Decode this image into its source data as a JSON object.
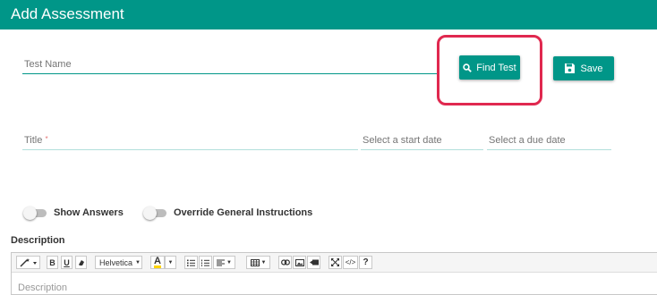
{
  "header": {
    "title": "Add Assessment"
  },
  "form": {
    "test_name_label": "Test Name",
    "title_label": "Title",
    "title_required_mark": "*",
    "start_date_label": "Select a start date",
    "due_date_label": "Select a due date"
  },
  "buttons": {
    "find_test": "Find Test",
    "save": "Save"
  },
  "toggles": {
    "show_answers": "Show Answers",
    "override_instructions": "Override General Instructions"
  },
  "description": {
    "label": "Description",
    "placeholder": "Description",
    "font_name": "Helvetica"
  },
  "colors": {
    "accent": "#009688",
    "highlight": "#e0284f"
  }
}
